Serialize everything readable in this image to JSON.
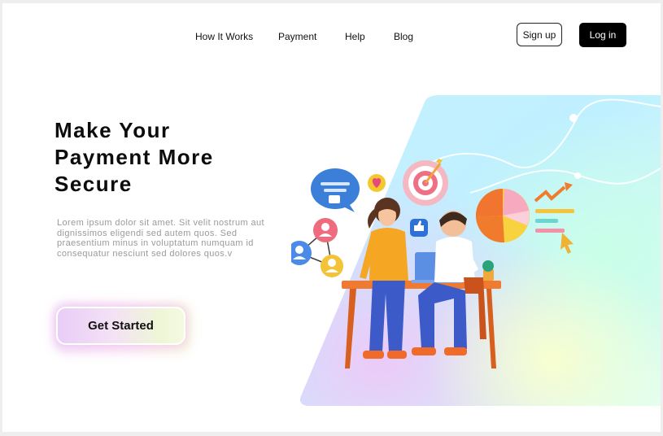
{
  "nav": {
    "links": [
      "How It Works",
      "Payment",
      "Help",
      "Blog"
    ],
    "signup_label": "Sign up",
    "login_label": "Log in"
  },
  "hero": {
    "title_line1": "Make Your",
    "title_line2": "Payment More",
    "title_line3": "Secure",
    "description": "Lorem ipsum dolor sit amet. Sit velit nostrum aut dignissimos eligendi sed autem quos. Sed praesentium minus in voluptatum numquam id consequatur nesciunt sed dolores quos.v",
    "cta_label": "Get Started"
  },
  "colors": {
    "primary_button": "#000000",
    "text": "#0c0c0c",
    "muted_text": "#9a9a9a",
    "page_background": "#ffffff"
  },
  "illustration": {
    "icons": [
      "chat-bubble-icon",
      "heart-icon",
      "target-icon",
      "pie-chart-icon",
      "trend-arrow-icon",
      "thumbs-up-icon",
      "network-people-icon",
      "cursor-icon"
    ]
  }
}
